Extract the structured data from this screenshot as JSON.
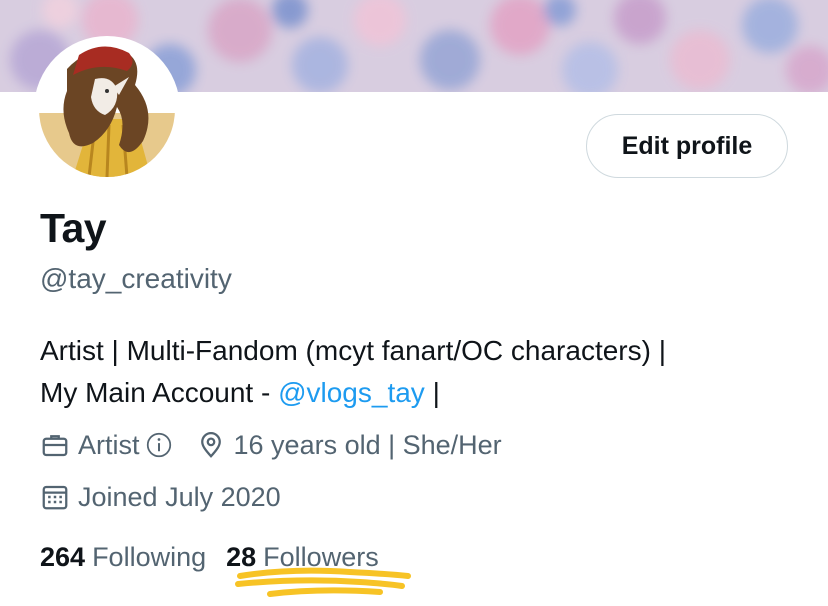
{
  "profile": {
    "name": "Tay",
    "handle": "@tay_creativity",
    "bio": {
      "line1": "Artist | Multi-Fandom (mcyt fanart/OC characters) |",
      "line2_prefix": "My Main Account - ",
      "mention": "@vlogs_tay",
      "line2_suffix": " |"
    },
    "meta": {
      "category": "Artist",
      "location": "16 years old | She/Her",
      "joined": "Joined July 2020"
    },
    "stats": {
      "following_count": "264",
      "following_label": "Following",
      "followers_count": "28",
      "followers_label": "Followers"
    }
  },
  "actions": {
    "edit_profile_label": "Edit profile"
  },
  "icons": {
    "category": "briefcase-icon",
    "info": "info-circle-icon",
    "location": "location-pin-icon",
    "calendar": "calendar-icon"
  },
  "colors": {
    "text": "#0f1419",
    "secondary": "#536471",
    "link": "#1d9bf0",
    "button_border": "#cfd9de",
    "highlight": "#f7c325"
  }
}
